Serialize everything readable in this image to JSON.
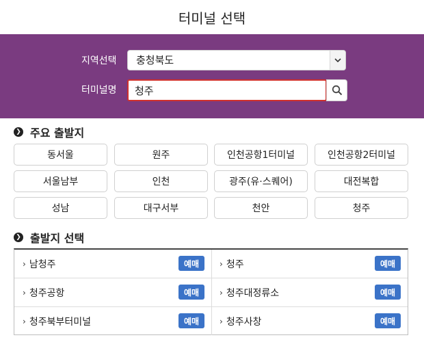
{
  "header": {
    "title": "터미널 선택"
  },
  "filter": {
    "region_label": "지역선택",
    "region_value": "충청북도",
    "terminal_label": "터미널명",
    "terminal_value": "청주"
  },
  "major": {
    "heading": "주요 출발지",
    "items": [
      "동서울",
      "원주",
      "인천공항1터미널",
      "인천공항2터미널",
      "서울남부",
      "인천",
      "광주(유·스퀘어)",
      "대전복합",
      "성남",
      "대구서부",
      "천안",
      "청주"
    ]
  },
  "departure": {
    "heading": "출발지 선택",
    "book_label": "예매",
    "items": [
      "남청주",
      "청주",
      "청주공항",
      "청주대정류소",
      "청주북부터미널",
      "청주사창"
    ]
  },
  "colors": {
    "panel": "#7a3b80",
    "book_button": "#3b73c8",
    "input_border": "#d0312d"
  },
  "icons": {
    "search": "search-icon",
    "dropdown": "chevron-down-icon",
    "bullet": "circle-chevron-right-icon",
    "row_arrow": "chevron-right-icon"
  }
}
